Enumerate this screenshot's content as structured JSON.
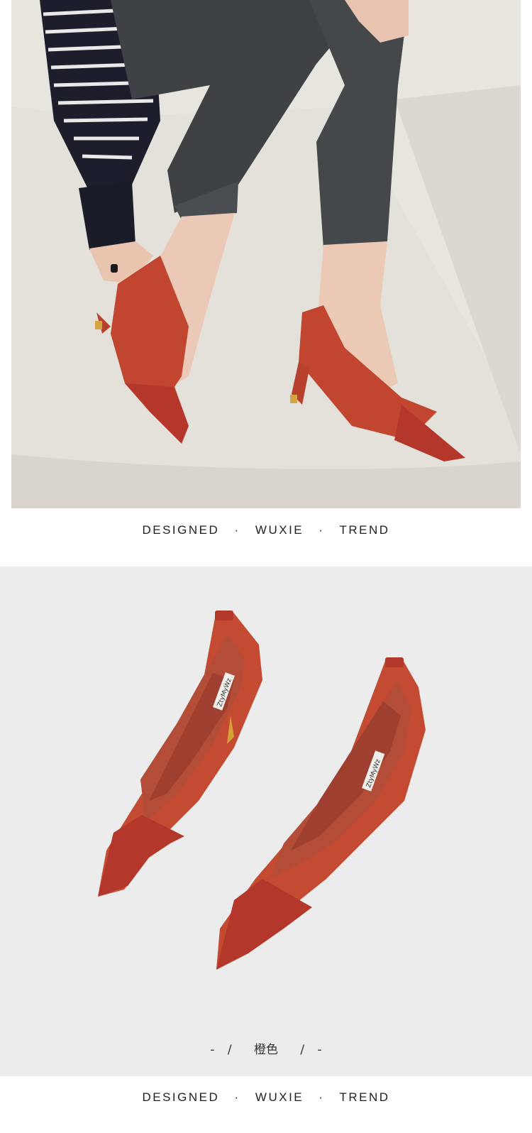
{
  "lifestyle_photo": {
    "alt": "model-wearing-red-pumps",
    "colors": {
      "shoe_suede": "#c0442f",
      "shoe_leather": "#b5382c",
      "jeans": "#3f4144",
      "sofa": "#e6e2dc",
      "floor": "#d9d6cf"
    }
  },
  "caption_top": {
    "part1": "DESIGNED",
    "dot1": "·",
    "part2": "WUXIE",
    "dot2": "·",
    "part3": "TREND"
  },
  "product_photo": {
    "alt": "red-pumps-pair-top-view",
    "insole_label_left": "ZtyMyWz",
    "insole_label_right": "ZtyMyWz"
  },
  "color_label": {
    "dash_left": "-",
    "slash_left": "/",
    "name": "橙色",
    "slash_right": "/",
    "dash_right": "-"
  },
  "caption_bottom": {
    "part1": "DESIGNED",
    "dot1": "·",
    "part2": "WUXIE",
    "dot2": "·",
    "part3": "TREND"
  }
}
